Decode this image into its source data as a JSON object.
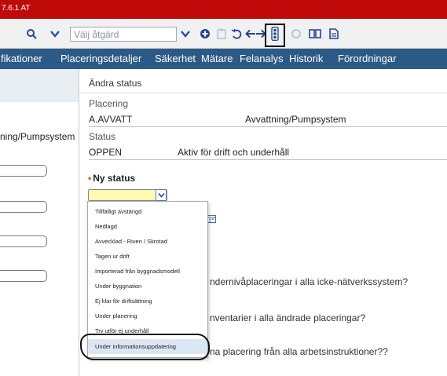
{
  "titlebar": {
    "text": "7.6.1 AT"
  },
  "toolbar": {
    "select_placeholder": "Välj åtgärd",
    "icons": [
      "search-icon",
      "chevron-down-icon",
      "chevron-down-icon",
      "add-circle-icon",
      "clipboard-icon",
      "undo-icon",
      "arrow-left-icon",
      "arrow-right-icon",
      "traffic-light-icon",
      "circle-icon",
      "book-icon",
      "document-icon"
    ]
  },
  "tabs": [
    "fikationer",
    "Placeringsdetaljer",
    "Säkerhet",
    "Mätare",
    "Felanalys",
    "Historik",
    "Förordningar"
  ],
  "background_form": {
    "label": "ning/Pumpsystem"
  },
  "dialog": {
    "title": "Ändra status",
    "placement_label": "Placering",
    "placement_code": "A.AVVATT",
    "placement_desc": "Avvattning/Pumpsystem",
    "status_label": "Status",
    "status_code": "OPPEN",
    "status_desc": "Aktiv för drift och underhåll",
    "new_status_label": "Ny status",
    "required_marker": "•",
    "q1": "ndernivåplaceringar i alla icke-nätverkssystem?",
    "q2": "nventarier i alla ändrade placeringar?",
    "q3": "na placering från alla arbetsinstruktioner??"
  },
  "dropdown": {
    "options": [
      "Tillfälligt avstängd",
      "Nedlagd",
      "Avvecklad - Riven / Skrotad",
      "Tagen ur drift",
      "Importerad från byggnadsmodell",
      "Under byggnation",
      "Ej klar för driftsättning",
      "Under planering",
      "Trv utför ej underhåll",
      "Under informationsuppdatering"
    ],
    "highlighted_index": 9
  },
  "colors": {
    "titlebar": "#c00a0a",
    "tabs": "#2c5a87",
    "toolbar": "#f1f1f1",
    "required": "#e05a00",
    "new_status_field": "#fff9b3"
  }
}
